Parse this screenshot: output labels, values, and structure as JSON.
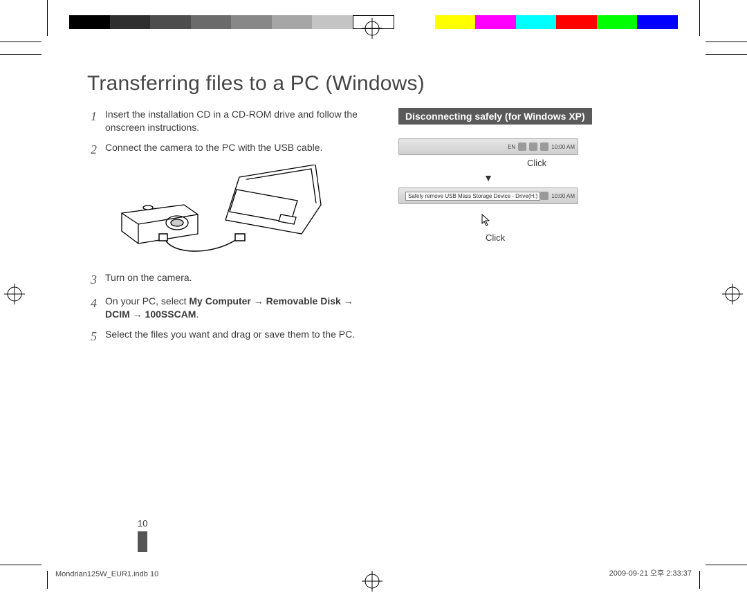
{
  "title": "Transferring files to a PC (Windows)",
  "steps": [
    {
      "num": "1",
      "text": "Insert the installation CD in a CD-ROM drive and follow the onscreen instructions."
    },
    {
      "num": "2",
      "text": "Connect the camera to the PC with the USB cable."
    },
    {
      "num": "3",
      "text": "Turn on the camera."
    },
    {
      "num": "4",
      "prefix": "On your PC, select ",
      "bold": "My Computer → Removable Disk → DCIM → 100SSCAM",
      "suffix": "."
    },
    {
      "num": "5",
      "text": "Select the files you want and drag or save them to the PC."
    }
  ],
  "callout": {
    "header": "Disconnecting safely (for Windows XP)",
    "click1": "Click",
    "arrow": "▼",
    "tooltip": "Safely remove USB Mass Storage Device - Drive(H:)",
    "click2": "Click",
    "taskbar_lang": "EN",
    "taskbar_time": "10:00 AM"
  },
  "page_number": "10",
  "footer": {
    "left": "Mondrian125W_EUR1.indb   10",
    "right": "2009-09-21   오후 2:33:37"
  },
  "color_bar": [
    "#000000",
    "#3a3a3a",
    "#5a5a5a",
    "#7a7a7a",
    "#9a9a9a",
    "#bababa",
    "#d6d6d6",
    "#ffffff",
    "#ffffff",
    "#ffff00",
    "#ff00ff",
    "#00ffff",
    "#ff0000",
    "#00ff00",
    "#0000ff"
  ]
}
